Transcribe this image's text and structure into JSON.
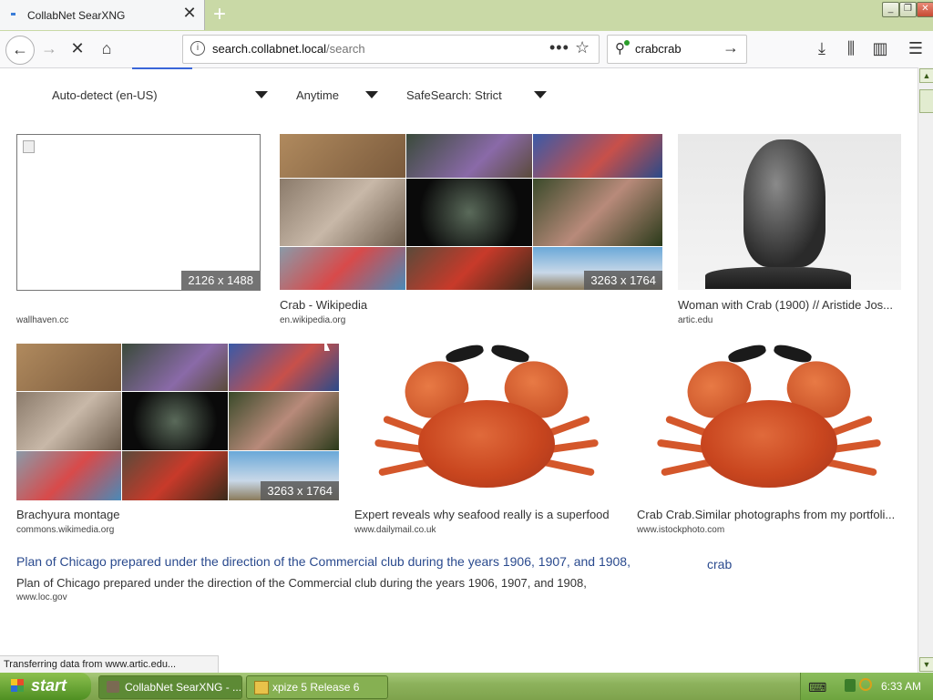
{
  "browser": {
    "tab_title": "CollabNet SearXNG",
    "url_host": "search.collabnet.local",
    "url_path": "/search",
    "search_value": "crabcrab"
  },
  "filters": {
    "language": "Auto-detect (en-US)",
    "time_range": "Anytime",
    "safesearch": "SafeSearch: Strict"
  },
  "results": [
    {
      "caption": "",
      "source": "wallhaven.cc",
      "dimensions": "2126 x 1488"
    },
    {
      "caption": "Crab - Wikipedia",
      "source": "en.wikipedia.org",
      "dimensions": "3263 x 1764"
    },
    {
      "caption": "Woman with Crab (1900) // Aristide Jos...",
      "source": "artic.edu",
      "dimensions": ""
    },
    {
      "caption": "Brachyura montage",
      "source": "commons.wikimedia.org",
      "dimensions": "3263 x 1764"
    },
    {
      "caption": "Expert reveals why seafood really is a superfood",
      "source": "www.dailymail.co.uk",
      "dimensions": ""
    },
    {
      "caption": "Crab Crab.Similar photographs from my portfoli...",
      "source": "www.istockphoto.com",
      "dimensions": ""
    }
  ],
  "text_result": {
    "title": "Plan of Chicago prepared under the direction of the Commercial club during the years 1906, 1907, and 1908,",
    "snippet": "Plan of Chicago prepared under the direction of the Commercial club during the years 1906, 1907, and 1908,",
    "source": "www.loc.gov"
  },
  "suggestion": "crab",
  "status_text": "Transferring data from www.artic.edu...",
  "taskbar": {
    "start_label": "start",
    "tasks": [
      "CollabNet SearXNG - ...",
      "xpize 5 Release 6"
    ],
    "clock": "6:33 AM"
  },
  "colors": {
    "accent_link": "#2a4a8e",
    "progress": "#3a66d8",
    "taskbar_green": "#8db25c"
  }
}
